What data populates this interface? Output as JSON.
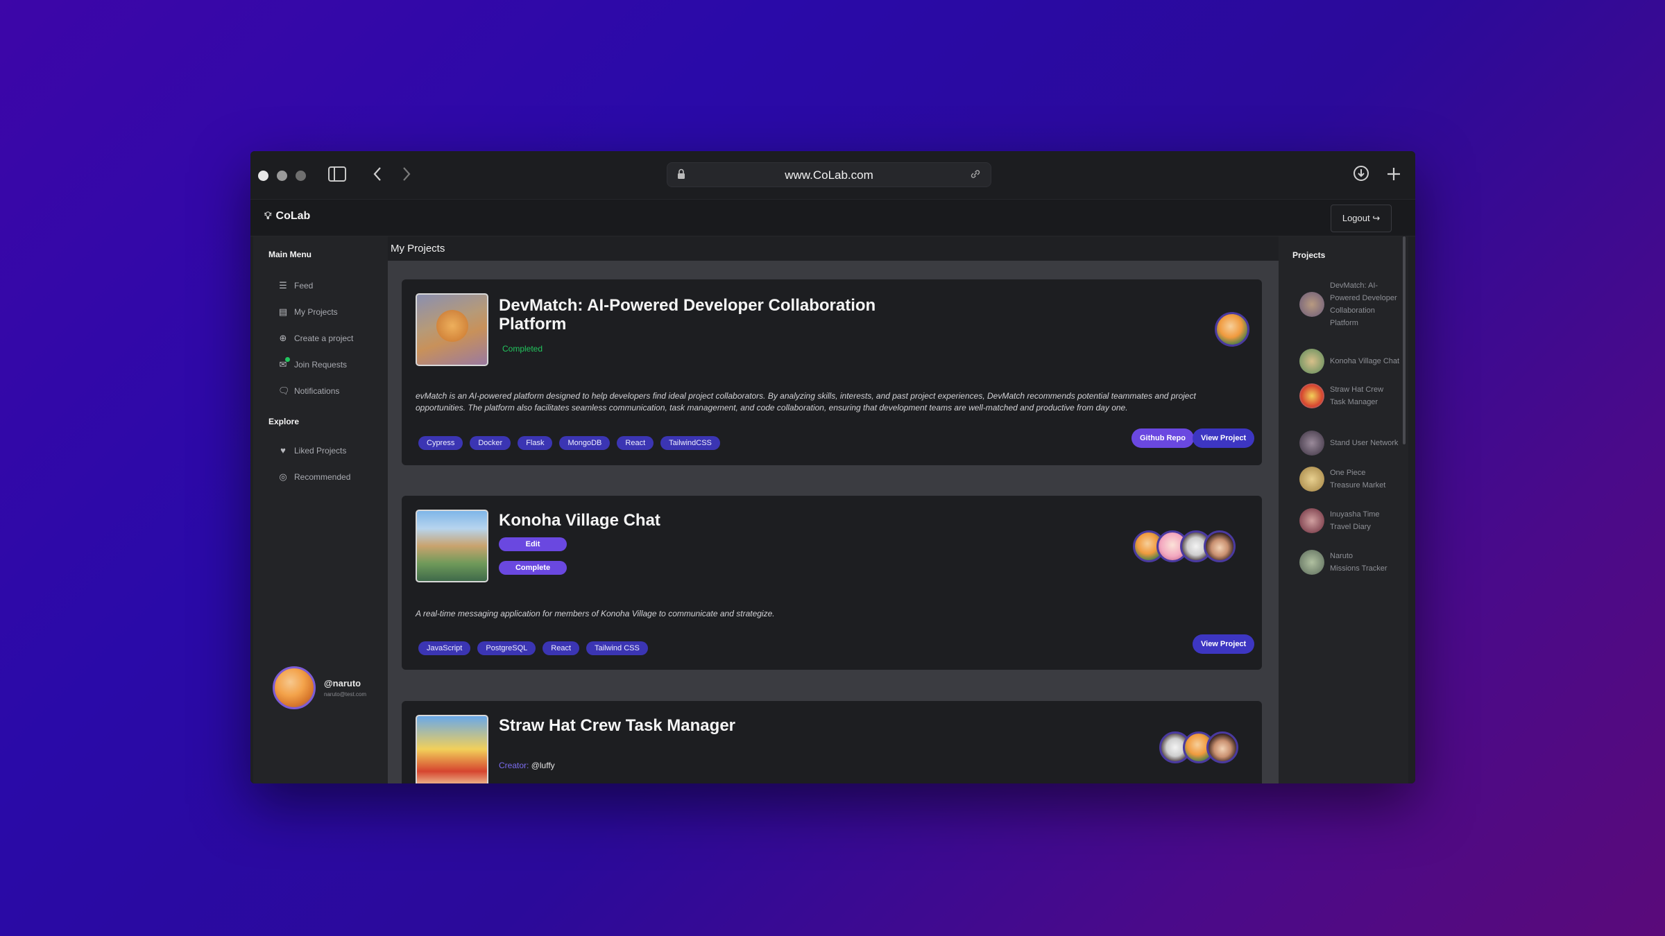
{
  "browser": {
    "url": "www.CoLab.com"
  },
  "app": {
    "brand": "CoLab",
    "logout_label": "Logout"
  },
  "sidebar": {
    "main_menu_title": "Main Menu",
    "items": [
      {
        "label": "Feed",
        "icon": "layers-icon"
      },
      {
        "label": "My Projects",
        "icon": "folder-icon"
      },
      {
        "label": "Create a project",
        "icon": "plus-circle-icon"
      },
      {
        "label": "Join Requests",
        "icon": "inbox-icon"
      },
      {
        "label": "Notifications",
        "icon": "chat-icon"
      }
    ],
    "explore_title": "Explore",
    "explore_items": [
      {
        "label": "Liked Projects",
        "icon": "heart-icon"
      },
      {
        "label": "Recommended",
        "icon": "target-icon"
      }
    ],
    "profile": {
      "username": "@naruto",
      "email": "naruto@test.com"
    }
  },
  "main": {
    "title": "My Projects",
    "projects": [
      {
        "title_line1": "DevMatch: AI-Powered Developer Collaboration",
        "title_line2": "Platform",
        "status": "Completed",
        "description_line1": "evMatch is an AI-powered platform designed to help developers find ideal project collaborators. By analyzing skills, interests, and past project experiences, DevMatch recommends potential teammates and project",
        "description_line2": "opportunities. The platform also facilitates seamless communication, task management, and code collaboration, ensuring that development teams are well-matched and productive from day one.",
        "tags": [
          "Cypress",
          "Docker",
          "Flask",
          "MongoDB",
          "React",
          "TailwindCSS"
        ],
        "github_label": "Github Repo",
        "view_label": "View Project"
      },
      {
        "title": "Konoha Village Chat",
        "edit_label": "Edit",
        "complete_label": "Complete",
        "description": "A real-time messaging application for members of Konoha Village to communicate and strategize.",
        "tags": [
          "JavaScript",
          "PostgreSQL",
          "React",
          "Tailwind CSS"
        ],
        "view_label": "View Project"
      },
      {
        "title": "Straw Hat Crew Task Manager",
        "creator_label": "Creator:",
        "creator": "@luffy"
      }
    ]
  },
  "rightbar": {
    "title": "Projects",
    "items": [
      {
        "line1": "DevMatch: AI-",
        "line2": "Powered Developer",
        "line3": "Collaboration",
        "line4": "Platform"
      },
      {
        "line1": "Konoha Village Chat"
      },
      {
        "line1": "Straw Hat Crew",
        "line2": "Task Manager"
      },
      {
        "line1": "Stand User Network"
      },
      {
        "line1": "One Piece",
        "line2": "Treasure Market"
      },
      {
        "line1": "Inuyasha Time",
        "line2": "Travel Diary"
      },
      {
        "line1": "Naruto",
        "line2": "Missions Tracker"
      }
    ]
  }
}
